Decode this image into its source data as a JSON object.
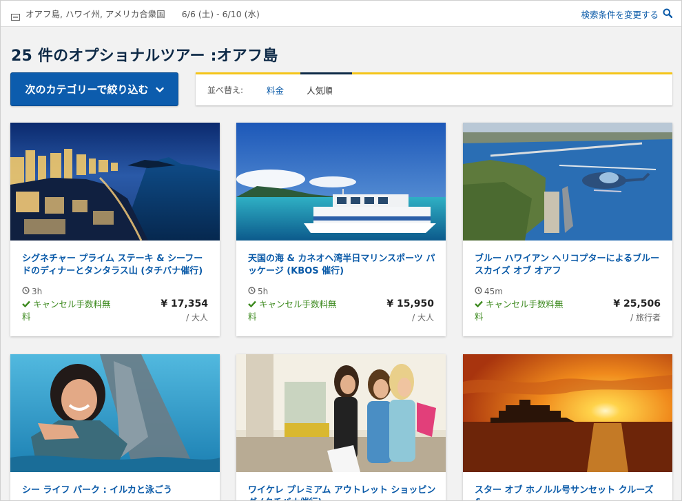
{
  "search": {
    "location": "オアフ島, ハワイ州, アメリカ合衆国",
    "dates": "6/6 (土) - 6/10 (水)",
    "change_label": "検索条件を変更する"
  },
  "heading": "25 件のオプショナルツアー :オアフ島",
  "filter_button": "次のカテゴリーで絞り込む",
  "sort": {
    "label": "並べ替え:",
    "options": [
      "料金",
      "人気順"
    ],
    "active": "人気順"
  },
  "tours": [
    {
      "title": "シグネチャー プライム ステーキ & シーフードのディナーとタンタラス山 (タチバナ催行)",
      "duration": "3h",
      "cancel": "キャンセル手数料無料",
      "price": "¥ 17,354",
      "unit": "/ 大人",
      "image": "waikiki-night-skyline"
    },
    {
      "title": "天国の海 & カネオヘ湾半日マリンスポーツ パッケージ (KBOS 催行)",
      "duration": "5h",
      "cancel": "キャンセル手数料無料",
      "price": "¥ 15,950",
      "unit": "/ 大人",
      "image": "catamaran-kaneohe-bay"
    },
    {
      "title": "ブルー ハワイアン ヘリコプターによるブルー スカイズ オブ オアフ",
      "duration": "45m",
      "cancel": "キャンセル手数料無料",
      "price": "¥ 25,506",
      "unit": "/ 旅行者",
      "image": "helicopter-pearl-harbor"
    },
    {
      "title": "シー ライフ パーク : イルカと泳ごう",
      "image": "dolphin-swim"
    },
    {
      "title": "ワイケレ プレミアム アウトレット ショッピング (タチバナ催行)",
      "image": "outlet-shopping"
    },
    {
      "title": "スター オブ ホノルル号サンセット クルーズ & ...",
      "image": "sunset-cruise"
    }
  ],
  "colors": {
    "accent_blue": "#0c5cad",
    "link_blue": "#0a5aa8",
    "heading_navy": "#0e2a47",
    "sort_border_yellow": "#f5c518",
    "cancel_green": "#3d8a1f"
  }
}
